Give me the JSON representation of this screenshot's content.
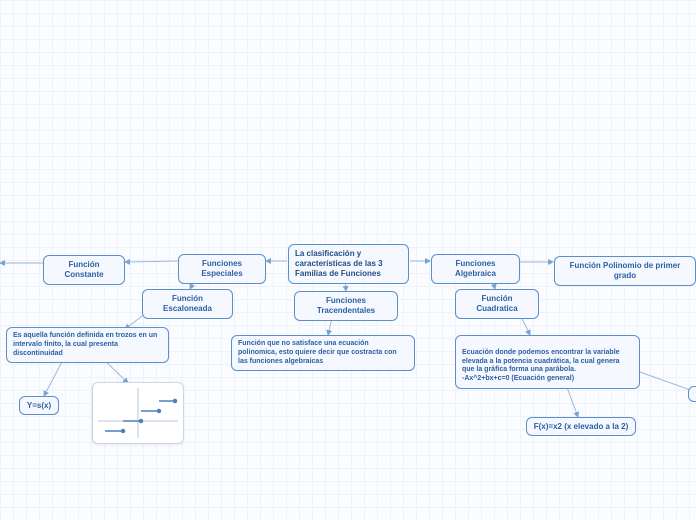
{
  "center": "La clasificación y características de las 3 Familias de Funciones",
  "especiales": "Funciones Especiales",
  "constante": "Función Constante",
  "escalonada": "Función Escaloneada",
  "escalonada_desc": "Es aquella función definida en trozos en un intervalo finito, la cual presenta discontinuidad",
  "escalonada_formula": "Y=s(x)",
  "tracend": "Funciones Tracendentales",
  "tracend_desc": "Función que no satisface una ecuación polinomica, esto quiere decir que costracta con las funciones algebraicas",
  "algebraica": "Funciones Algebraica",
  "polinomio": "Función Polinomio de primer grado",
  "cuadratica": "Función Cuadratica",
  "cuadratica_desc": "Ecuación donde podemos encontrar la variable elevada a la potencia cuadrática, la cual genera que la gráfica forma una parábola.\n-Ax^2+bx+c=0  (Ecuación general)",
  "cuadratica_formula": "F(x)=x2 (x elevado a la 2)"
}
